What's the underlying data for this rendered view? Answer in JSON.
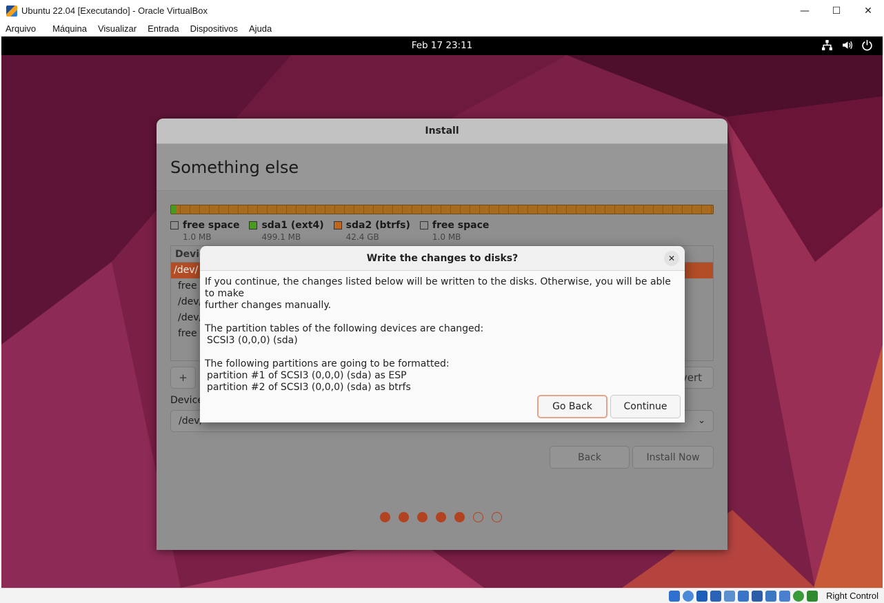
{
  "window": {
    "title": "Ubuntu 22.04 [Executando] - Oracle VirtualBox",
    "controls": {
      "minimize": "—",
      "maximize": "☐",
      "close": "✕"
    }
  },
  "menubar": [
    "Arquivo",
    "Máquina",
    "Visualizar",
    "Entrada",
    "Dispositivos",
    "Ajuda"
  ],
  "topbar": {
    "clock": "Feb 17  23:11",
    "tray_icons": [
      "network-icon",
      "volume-icon",
      "power-icon"
    ]
  },
  "installer": {
    "title": "Install",
    "heading": "Something else",
    "legend": [
      {
        "label": "free space",
        "size": "1.0 MB",
        "color": "transparent"
      },
      {
        "label": "sda1 (ext4)",
        "size": "499.1 MB",
        "color": "#4a9a1e"
      },
      {
        "label": "sda2 (btrfs)",
        "size": "42.4 GB",
        "color": "#c0661d"
      },
      {
        "label": "free space",
        "size": "1.0 MB",
        "color": "transparent"
      }
    ],
    "table_header": "Devic",
    "rows": [
      "/dev/",
      "free",
      "/dev/",
      "/dev/",
      "free"
    ],
    "add_button": "+",
    "revert_button": "vert",
    "device_label": "Device",
    "device_value": "/dev/",
    "back_button": "Back",
    "install_button": "Install Now",
    "progress": {
      "filled": 5,
      "total": 7
    }
  },
  "dialog": {
    "title": "Write the changes to disks?",
    "close": "✕",
    "line1": "If you continue, the changes listed below will be written to the disks. Otherwise, you will be able to make",
    "line2": "further changes manually.",
    "tables_heading": "The partition tables of the following devices are changed:",
    "tables_item": "SCSI3 (0,0,0) (sda)",
    "format_heading": "The following partitions are going to be formatted:",
    "format_item1": "partition #1 of SCSI3 (0,0,0) (sda) as ESP",
    "format_item2": "partition #2 of SCSI3 (0,0,0) (sda) as btrfs",
    "go_back": "Go Back",
    "continue": "Continue"
  },
  "statusbar": {
    "host_key": "Right Control"
  }
}
